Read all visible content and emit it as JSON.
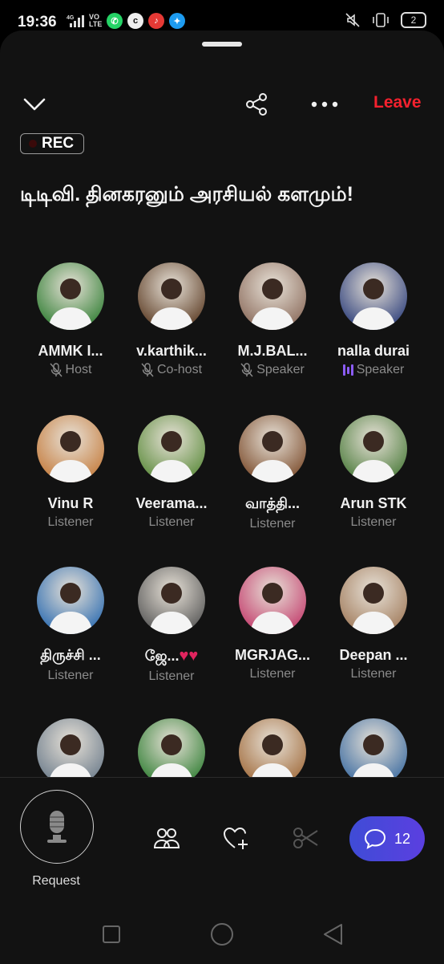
{
  "status": {
    "time": "19:36",
    "network": "4G",
    "volte": "VO LTE",
    "battery": "2"
  },
  "header": {
    "leave_label": "Leave",
    "rec_label": "REC"
  },
  "space": {
    "title": "டிடிவி. தினகரனும் அரசியல் களமும்!"
  },
  "participants": [
    {
      "name": "AMMK I...",
      "role": "Host",
      "role_icon": "mic-off-icon",
      "color": "#2f7d32"
    },
    {
      "name": "v.karthik...",
      "role": "Co-host",
      "role_icon": "mic-off-icon",
      "color": "#5a3a22"
    },
    {
      "name": "M.J.BAL...",
      "role": "Speaker",
      "role_icon": "mic-off-icon",
      "color": "#8a6a5a"
    },
    {
      "name": "nalla durai",
      "role": "Speaker",
      "role_icon": "speaking-wave-icon",
      "color": "#2b3d7a"
    },
    {
      "name": "Vinu R",
      "role": "Listener",
      "color": "#c47a3a"
    },
    {
      "name": "Veerama...",
      "role": "Listener",
      "color": "#5a8a3a"
    },
    {
      "name": "வாத்தி...",
      "role": "Listener",
      "color": "#7a4a2a"
    },
    {
      "name": "Arun STK",
      "role": "Listener",
      "color": "#4a7a3a"
    },
    {
      "name": "திருச்சி ...",
      "role": "Listener",
      "color": "#2a6ab0"
    },
    {
      "name": "ஜே...",
      "role": "Listener",
      "extra": "♥♥",
      "color": "#555555"
    },
    {
      "name": "MGRJAG...",
      "role": "Listener",
      "color": "#c23a6a"
    },
    {
      "name": "Deepan ...",
      "role": "Listener",
      "color": "#a07a5a"
    },
    {
      "name": "",
      "role": "",
      "color": "#6a7a8a"
    },
    {
      "name": "",
      "role": "",
      "color": "#2f7d32"
    },
    {
      "name": "",
      "role": "",
      "color": "#a06a3a"
    },
    {
      "name": "",
      "role": "",
      "color": "#3a6aa0"
    }
  ],
  "bottom": {
    "request_label": "Request",
    "comment_count": "12"
  }
}
